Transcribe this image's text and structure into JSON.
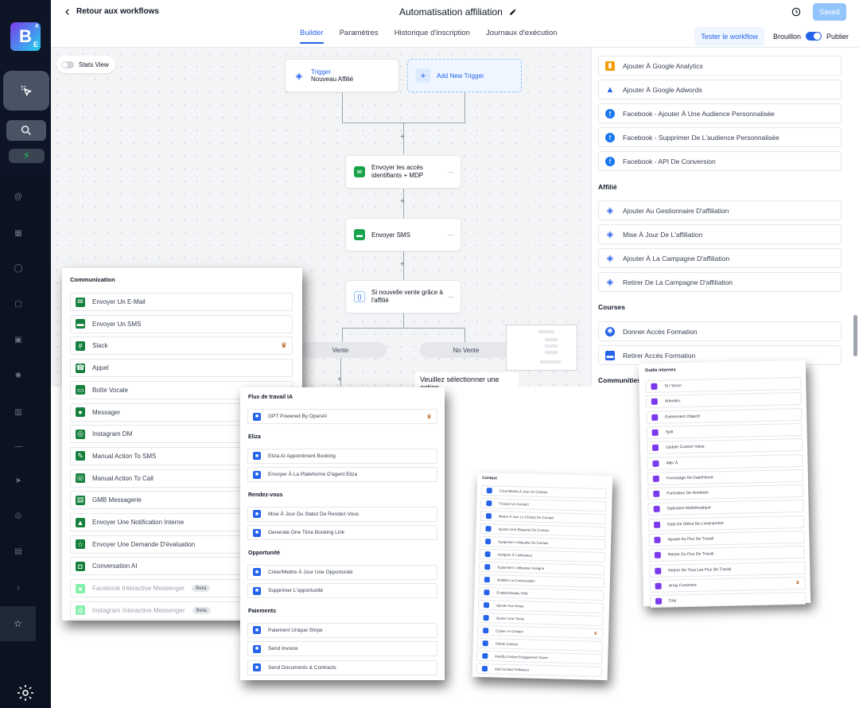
{
  "app": {
    "logo_letter": "B",
    "logo_sub": "E",
    "logo_sup": "4"
  },
  "header": {
    "back_label": "Retour aux workflows",
    "title": "Automatisation affiliation",
    "saved_label": "Saved",
    "tabs": [
      {
        "label": "Builder",
        "active": true
      },
      {
        "label": "Paramètres",
        "active": false
      },
      {
        "label": "Historique d'inscription",
        "active": false
      },
      {
        "label": "Journaux d'exécution",
        "active": false
      }
    ],
    "test_label": "Tester le workflow",
    "draft_label": "Brouillon",
    "publish_label": "Publier"
  },
  "canvas": {
    "stats_label": "Stats View",
    "trigger": {
      "title": "Trigger",
      "subtitle": "Nouveau Affilié"
    },
    "add_trigger_label": "Add New Trigger",
    "steps": [
      {
        "label": "Envoyer les accès identifiants + MDP"
      },
      {
        "label": "Envoyer SMS"
      },
      {
        "label": "Si nouvelle vente grâce à l'affilié"
      }
    ],
    "branches": [
      "Vente",
      "No Vente"
    ],
    "select_message": "Veuillez sélectionner une action"
  },
  "right_panel": {
    "items_top": [
      {
        "label": "Ajouter À Google Analytics",
        "icon": "google-analytics-icon",
        "color": "#2563eb"
      },
      {
        "label": "Ajouter À Google Adwords",
        "icon": "google-ads-icon",
        "color": "#2563eb"
      },
      {
        "label": "Facebook - Ajouter À Une Audience Personnalisée",
        "icon": "facebook-icon",
        "color": "#1877f2"
      },
      {
        "label": "Facebook - Supprimer De L'audience Personnalisée",
        "icon": "facebook-icon",
        "color": "#1877f2"
      },
      {
        "label": "Facebook - API De Conversion",
        "icon": "facebook-icon",
        "color": "#1877f2"
      }
    ],
    "affiliate_title": "Affilié",
    "affiliate_items": [
      {
        "label": "Ajouter Au Gestionnaire D'affiliation"
      },
      {
        "label": "Mise À Jour De L'affiliation"
      },
      {
        "label": "Ajouter À La Campagne D'affiliation"
      },
      {
        "label": "Retirer De La Campagne D'affiliation"
      }
    ],
    "courses_title": "Courses",
    "courses_items": [
      {
        "label": "Donner Accès Formation"
      },
      {
        "label": "Retirer Accès Formation"
      }
    ],
    "communities_title": "Communities"
  },
  "communication": {
    "title": "Communication",
    "items": [
      {
        "label": "Envoyer Un E-Mail",
        "icon": "mail-icon",
        "crown": false,
        "dim": false
      },
      {
        "label": "Envoyer Un SMS",
        "icon": "sms-icon",
        "crown": false,
        "dim": false
      },
      {
        "label": "Slack",
        "icon": "slack-icon",
        "crown": true,
        "dim": false
      },
      {
        "label": "Appel",
        "icon": "phone-icon",
        "crown": false,
        "dim": false
      },
      {
        "label": "Boîte Vocale",
        "icon": "voicemail-icon",
        "crown": false,
        "dim": false
      },
      {
        "label": "Messager",
        "icon": "messenger-icon",
        "crown": false,
        "dim": false
      },
      {
        "label": "Instagram DM",
        "icon": "instagram-icon",
        "crown": false,
        "dim": false
      },
      {
        "label": "Manual Action To SMS",
        "icon": "manual-sms-icon",
        "crown": false,
        "dim": false
      },
      {
        "label": "Manual Action To Call",
        "icon": "manual-call-icon",
        "crown": false,
        "dim": false
      },
      {
        "label": "GMB Messagerie",
        "icon": "gmb-icon",
        "crown": false,
        "dim": false
      },
      {
        "label": "Envoyer Une Notification Interne",
        "icon": "bell-icon",
        "crown": false,
        "dim": false
      },
      {
        "label": "Envoyer Une Demande D'évaluation",
        "icon": "review-icon",
        "crown": false,
        "dim": false
      },
      {
        "label": "Conversation AI",
        "icon": "robot-icon",
        "crown": false,
        "dim": false
      },
      {
        "label": "Facebook Interactive Messenger",
        "icon": "messenger-icon",
        "crown": false,
        "dim": true,
        "badge": "Beta"
      },
      {
        "label": "Instagram Interactive Messenger",
        "icon": "instagram-icon",
        "crown": false,
        "dim": true,
        "badge": "Beta"
      }
    ]
  },
  "ai_panel": {
    "sections": [
      {
        "title": "Flux de travail IA",
        "items": [
          {
            "label": "GPT Powered By OpenAI",
            "crown": true
          }
        ]
      },
      {
        "title": "Eliza",
        "items": [
          {
            "label": "Eliza AI Appointment Booking"
          },
          {
            "label": "Envoyer À La Plateforme D'agent Eliza"
          }
        ]
      },
      {
        "title": "Rendez-vous",
        "items": [
          {
            "label": "Mise À Jour Du Statut De Rendez-Vous"
          },
          {
            "label": "Generate One Time Booking Link"
          }
        ]
      },
      {
        "title": "Opportunité",
        "items": [
          {
            "label": "Créer/Mettre À Jour Une Opportunité"
          },
          {
            "label": "Supprimer L'opportunité"
          }
        ]
      },
      {
        "title": "Paiements",
        "items": [
          {
            "label": "Paiement Unique Stripe"
          },
          {
            "label": "Send Invoice"
          },
          {
            "label": "Send Documents & Contracts"
          }
        ]
      }
    ]
  },
  "contact_panel": {
    "title": "Contact",
    "items": [
      "Créer/Mettre À Jour Un Contact",
      "Trouver Un Contact",
      "Mettre À Jour Le Champ De Contact",
      "Ajouter Une Étiquette De Contact",
      "Supprimer L'étiquette De Contact",
      "Assigner À L'utilisateur",
      "Supprimer L'utilisateur Assigné",
      "Modifier La Conversation",
      "Enable/Disable DND",
      "Ajouter Aux Notes",
      "Ajouter Une Tâche",
      "Copier Le Contact",
      "Delete Contact",
      "Modify Contact Engagement Score",
      "Add Contact Followers"
    ]
  },
  "internal_panel": {
    "title": "Outils internes",
    "items": [
      "Si / Sinon",
      "Attendez",
      "Événement Objectif",
      "Split",
      "Update Custom Value",
      "Aller À",
      "Formatage De Date/Heure",
      "Formateur De Nombres",
      "Opération Mathématique",
      "Date De Début De L'événement",
      "Ajouter Au Flux De Travail",
      "Retirer Du Flux De Travail",
      "Retirer De Tous Les Flux De Travail",
      "Array Functions",
      "Drip"
    ]
  }
}
